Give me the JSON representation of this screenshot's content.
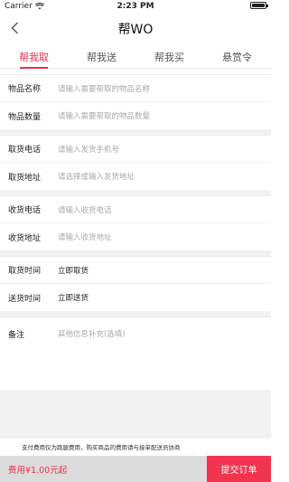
{
  "status_bar": {
    "carrier": "Carrier",
    "time": "2:23 PM"
  },
  "header": {
    "title": "帮WO"
  },
  "tabs": [
    {
      "label": "帮我取",
      "active": true
    },
    {
      "label": "帮我送",
      "active": false
    },
    {
      "label": "帮我买",
      "active": false
    },
    {
      "label": "悬赏令",
      "active": false
    }
  ],
  "form": {
    "item_name": {
      "label": "物品名称",
      "placeholder": "请输入需要帮取的物品名称"
    },
    "item_qty": {
      "label": "物品数量",
      "placeholder": "请输入需要帮取的物品数量"
    },
    "pickup_phone": {
      "label": "取货电话",
      "placeholder": "请输入发货手机号"
    },
    "pickup_addr": {
      "label": "取货地址",
      "placeholder": "请选择或输入发货地址"
    },
    "recv_phone": {
      "label": "收货电话",
      "placeholder": "请输入收货电话"
    },
    "recv_addr": {
      "label": "收货地址",
      "placeholder": "请输入收货地址"
    },
    "pickup_time": {
      "label": "取货时间",
      "value": "立即取货"
    },
    "delivery_time": {
      "label": "送货时间",
      "value": "立即送货"
    },
    "remark": {
      "label": "备注",
      "placeholder": "其他信息补充(选填)"
    }
  },
  "notice": "支付费用仅为跑腿费用，购买商品的费用请与接单配送员协商",
  "footer": {
    "fee": "费用¥1.00元起",
    "submit": "提交订单"
  },
  "colors": {
    "accent": "#e8324b",
    "submit_bg": "#f2344f"
  }
}
